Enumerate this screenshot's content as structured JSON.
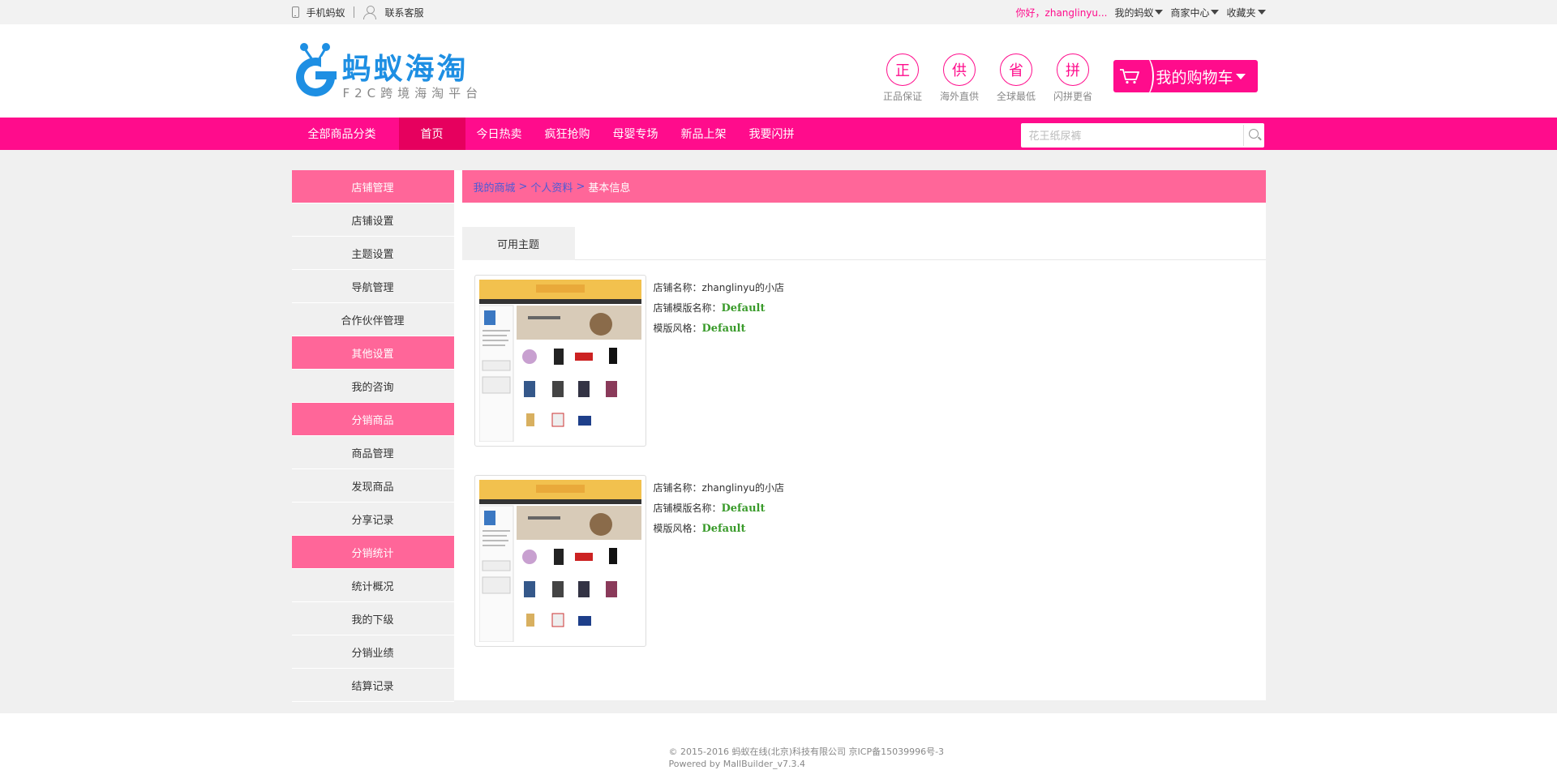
{
  "topbar": {
    "mobile": "手机蚂蚁",
    "service": "联系客服",
    "hello": "你好，zhanglinyu...",
    "my_ant": "我的蚂蚁",
    "merchant": "商家中心",
    "favorites": "收藏夹"
  },
  "logo": {
    "title": "蚂蚁海淘",
    "subtitle": "F2C跨境海淘平台"
  },
  "promises": [
    {
      "glyph": "正",
      "caption": "正品保证"
    },
    {
      "glyph": "供",
      "caption": "海外直供"
    },
    {
      "glyph": "省",
      "caption": "全球最低"
    },
    {
      "glyph": "拼",
      "caption": "闪拼更省"
    }
  ],
  "cart": {
    "label": "我的购物车"
  },
  "nav": {
    "all": "全部商品分类",
    "items": [
      "首页",
      "今日热卖",
      "疯狂抢购",
      "母婴专场",
      "新品上架",
      "我要闪拼"
    ]
  },
  "search": {
    "placeholder": "花王纸尿裤"
  },
  "sidebar": [
    {
      "type": "head",
      "label": "店铺管理"
    },
    {
      "type": "item",
      "label": "店铺设置"
    },
    {
      "type": "item",
      "label": "主题设置"
    },
    {
      "type": "item",
      "label": "导航管理"
    },
    {
      "type": "item",
      "label": "合作伙伴管理"
    },
    {
      "type": "head",
      "label": "其他设置"
    },
    {
      "type": "item",
      "label": "我的咨询"
    },
    {
      "type": "head",
      "label": "分销商品"
    },
    {
      "type": "item",
      "label": "商品管理"
    },
    {
      "type": "item",
      "label": "发现商品"
    },
    {
      "type": "item",
      "label": "分享记录"
    },
    {
      "type": "head",
      "label": "分销统计"
    },
    {
      "type": "item",
      "label": "统计概况"
    },
    {
      "type": "item",
      "label": "我的下级"
    },
    {
      "type": "item",
      "label": "分销业绩"
    },
    {
      "type": "item",
      "label": "结算记录"
    }
  ],
  "breadcrumb": {
    "home": "我的商城",
    "sep": ">",
    "profile": "个人资料",
    "current": "基本信息"
  },
  "tab": {
    "label": "可用主题"
  },
  "themes": [
    {
      "name_label": "店铺名称：",
      "name": "zhanglinyu的小店",
      "tpl_label": "店铺模版名称：",
      "tpl": "Default",
      "style_label": "模版风格：",
      "style": "Default"
    },
    {
      "name_label": "店铺名称：",
      "name": "zhanglinyu的小店",
      "tpl_label": "店铺模版名称：",
      "tpl": "Default",
      "style_label": "模版风格：",
      "style": "Default"
    }
  ],
  "footer": {
    "copyright": "© 2015-2016 蚂蚁在线(北京)科技有限公司 京ICP备15039996号-3",
    "powered": "Powered by MallBuilder_v7.3.4"
  },
  "colors": {
    "brand_pink": "#ff0c8c",
    "side_pink": "#ff6699",
    "logo_blue": "#1e8fe3",
    "green": "#3a9b2b"
  }
}
